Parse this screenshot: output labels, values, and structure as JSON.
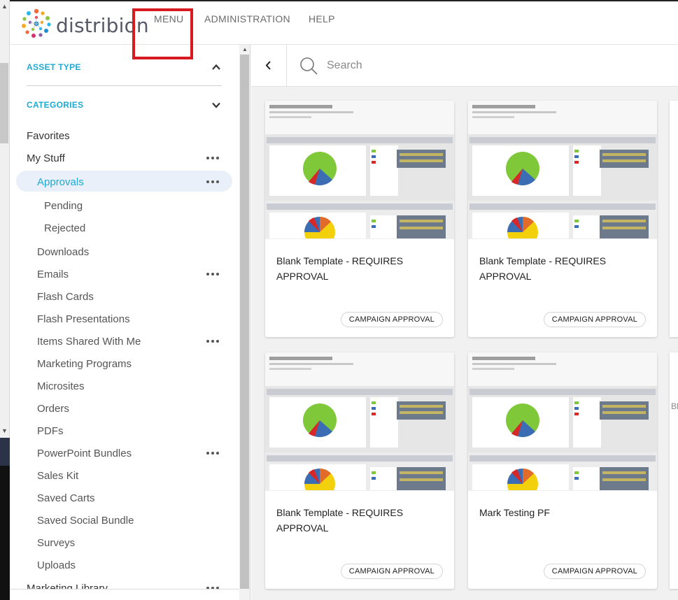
{
  "brand": {
    "name": "distribion"
  },
  "nav": {
    "menu": "MENU",
    "administration": "ADMINISTRATION",
    "help": "HELP"
  },
  "sidebar": {
    "asset_type": "ASSET TYPE",
    "categories": "CATEGORIES",
    "favorites": "Favorites",
    "my_stuff": "My Stuff",
    "approvals": "Approvals",
    "pending": "Pending",
    "rejected": "Rejected",
    "items": [
      "Downloads",
      "Emails",
      "Flash Cards",
      "Flash Presentations",
      "Items Shared With Me",
      "Marketing Programs",
      "Microsites",
      "Orders",
      "PDFs",
      "PowerPoint Bundles",
      "Sales Kit",
      "Saved Carts",
      "Saved Social Bundle",
      "Surveys",
      "Uploads"
    ],
    "marketing_library": "Marketing Library"
  },
  "search": {
    "placeholder": "Search"
  },
  "cards": [
    {
      "title": "Blank Template - REQUIRES APPROVAL",
      "badge": "CAMPAIGN APPROVAL"
    },
    {
      "title": "Blank Template - REQUIRES APPROVAL",
      "badge": "CAMPAIGN APPROVAL"
    },
    {
      "title": "Blank Template - REQUIRES APPROVAL",
      "badge": "CAMPAIGN APPROVAL"
    },
    {
      "title": "Mark Testing PF",
      "badge": "CAMPAIGN APPROVAL"
    }
  ],
  "partial_text": "Bl",
  "colors": {
    "accent": "#1eaad1",
    "highlight": "#d71920",
    "selected_bg": "#eaf0fa"
  }
}
